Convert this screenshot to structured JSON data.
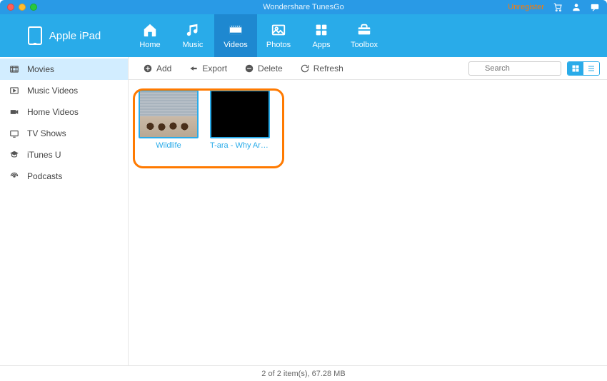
{
  "titlebar": {
    "app_title": "Wondershare TunesGo",
    "unregister_label": "Unregister"
  },
  "device": {
    "name": "Apple iPad"
  },
  "nav": {
    "items": [
      {
        "label": "Home",
        "icon": "home-icon"
      },
      {
        "label": "Music",
        "icon": "music-icon"
      },
      {
        "label": "Videos",
        "icon": "video-icon",
        "active": true
      },
      {
        "label": "Photos",
        "icon": "photos-icon"
      },
      {
        "label": "Apps",
        "icon": "apps-icon"
      },
      {
        "label": "Toolbox",
        "icon": "toolbox-icon"
      }
    ]
  },
  "sidebar": {
    "items": [
      {
        "label": "Movies",
        "icon": "movies-side-icon",
        "selected": true
      },
      {
        "label": "Music Videos",
        "icon": "music-videos-side-icon"
      },
      {
        "label": "Home Videos",
        "icon": "home-videos-side-icon"
      },
      {
        "label": "TV Shows",
        "icon": "tv-shows-side-icon"
      },
      {
        "label": "iTunes U",
        "icon": "itunesu-side-icon"
      },
      {
        "label": "Podcasts",
        "icon": "podcasts-side-icon"
      }
    ]
  },
  "toolbar": {
    "add_label": "Add",
    "export_label": "Export",
    "delete_label": "Delete",
    "refresh_label": "Refresh",
    "search_placeholder": "Search"
  },
  "items": [
    {
      "caption": "Wildlife",
      "kind": "wildlife"
    },
    {
      "caption": "T-ara - Why Are...",
      "kind": "black"
    }
  ],
  "status": {
    "text": "2 of 2 item(s), 67.28 MB"
  }
}
